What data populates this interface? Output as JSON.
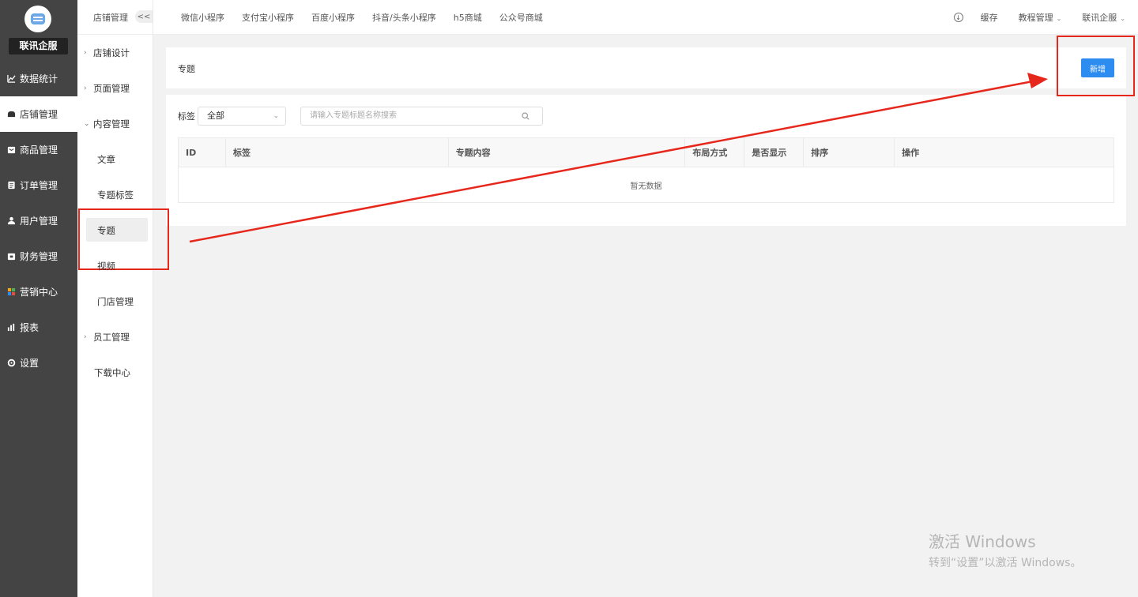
{
  "brand": {
    "name": "联讯企服"
  },
  "nav_main": [
    {
      "label": "数据统计",
      "icon": "chart-line-icon"
    },
    {
      "label": "店铺管理",
      "icon": "store-icon",
      "active": true
    },
    {
      "label": "商品管理",
      "icon": "box-icon"
    },
    {
      "label": "订单管理",
      "icon": "clipboard-icon"
    },
    {
      "label": "用户管理",
      "icon": "user-icon"
    },
    {
      "label": "财务管理",
      "icon": "wallet-icon"
    },
    {
      "label": "营销中心",
      "icon": "puzzle-icon"
    },
    {
      "label": "报表",
      "icon": "bar-chart-icon"
    },
    {
      "label": "设置",
      "icon": "gear-icon"
    }
  ],
  "nav_sub": {
    "header": "店铺管理",
    "collapse_label": "<<",
    "items": [
      {
        "label": "店铺设计",
        "type": "grp",
        "chev": "›"
      },
      {
        "label": "页面管理",
        "type": "grp",
        "chev": "›"
      },
      {
        "label": "内容管理",
        "type": "grp",
        "chev": "⌄"
      },
      {
        "label": "文章",
        "type": "sub"
      },
      {
        "label": "专题标签",
        "type": "sub"
      },
      {
        "label": "专题",
        "type": "sub",
        "selected": true
      },
      {
        "label": "视频",
        "type": "sub"
      },
      {
        "label": "门店管理",
        "type": "sub"
      },
      {
        "label": "员工管理",
        "type": "grp",
        "chev": "›"
      },
      {
        "label": "下载中心",
        "type": "plain"
      }
    ]
  },
  "top_tabs": [
    "微信小程序",
    "支付宝小程序",
    "百度小程序",
    "抖音/头条小程序",
    "h5商城",
    "公众号商城"
  ],
  "top_tools": {
    "cache": "缓存",
    "tutorial": "教程管理",
    "account": "联讯企服"
  },
  "page": {
    "title": "专题",
    "add_button": "新增",
    "filter_label": "标签",
    "filter_value": "全部",
    "search_placeholder": "请输入专题标题名称搜索",
    "columns": [
      "ID",
      "标签",
      "专题内容",
      "布局方式",
      "是否显示",
      "排序",
      "操作"
    ],
    "empty_text": "暂无数据"
  },
  "watermark": {
    "line1": "激活 Windows",
    "line2": "转到“设置”以激活 Windows。"
  },
  "colors": {
    "sidebar": "#444444",
    "primary": "#2d8cf0",
    "annotation": "#e6271c"
  }
}
